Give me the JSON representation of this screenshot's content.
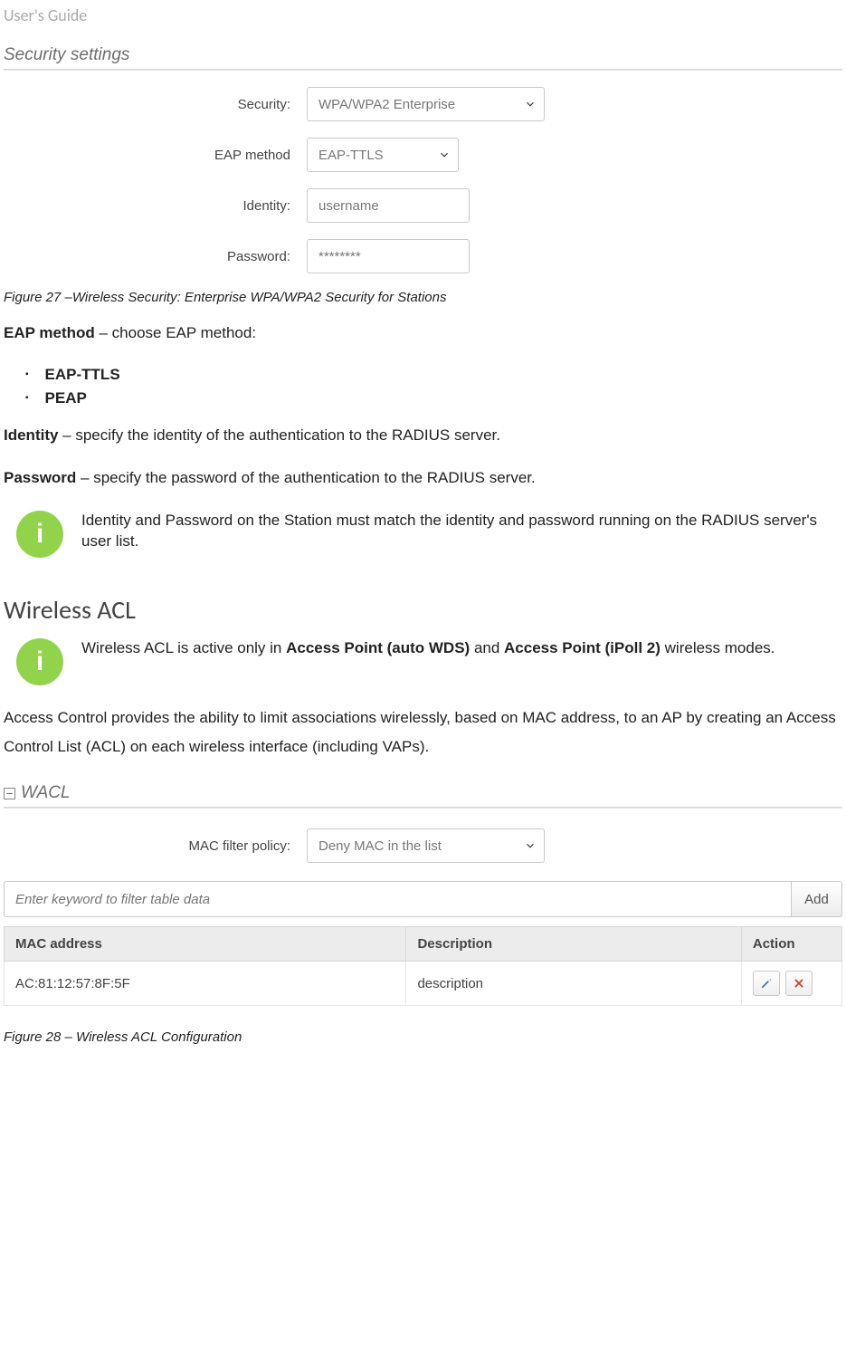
{
  "header": {
    "note": "User's Guide"
  },
  "security_panel": {
    "title": "Security settings",
    "rows": {
      "security": {
        "label": "Security:",
        "value": "WPA/WPA2 Enterprise"
      },
      "eap": {
        "label": "EAP method",
        "value": "EAP-TTLS"
      },
      "identity": {
        "label": "Identity:",
        "value": "username"
      },
      "password": {
        "label": "Password:",
        "value": "********"
      }
    }
  },
  "fig27": "Figure 27 –Wireless Security: Enterprise WPA/WPA2 Security for Stations",
  "eap_method_intro": {
    "bold": "EAP method",
    "rest": " – choose EAP method:"
  },
  "eap_list": [
    "EAP-TTLS",
    "PEAP"
  ],
  "identity_line": {
    "bold": "Identity",
    "rest": " – specify the identity of the authentication to the RADIUS server."
  },
  "password_line": {
    "bold": "Password",
    "rest": " – specify the password of the authentication to the RADIUS server."
  },
  "info1": "Identity and Password on the Station must match the identity and password running on the RADIUS server's user list.",
  "section2": "Wireless ACL",
  "info2": {
    "pre": "Wireless ACL is active only in ",
    "b1": "Access Point (auto WDS)",
    "mid": " and ",
    "b2": "Access Point (iPoll 2)",
    "post": " wireless modes."
  },
  "acl_intro": "Access Control provides the ability to limit associations wirelessly, based on MAC address, to an AP by creating an Access Control List (ACL) on each wireless interface (including VAPs).",
  "wacl": {
    "title": "WACL",
    "filter_label": "MAC filter policy:",
    "filter_value": "Deny MAC in the list",
    "search_placeholder": "Enter keyword to filter table data",
    "add_btn": "Add",
    "headers": {
      "mac": "MAC address",
      "desc": "Description",
      "action": "Action"
    },
    "rows": [
      {
        "mac": "AC:81:12:57:8F:5F",
        "desc": "description"
      }
    ]
  },
  "fig28": "Figure 28 – Wireless ACL Configuration"
}
